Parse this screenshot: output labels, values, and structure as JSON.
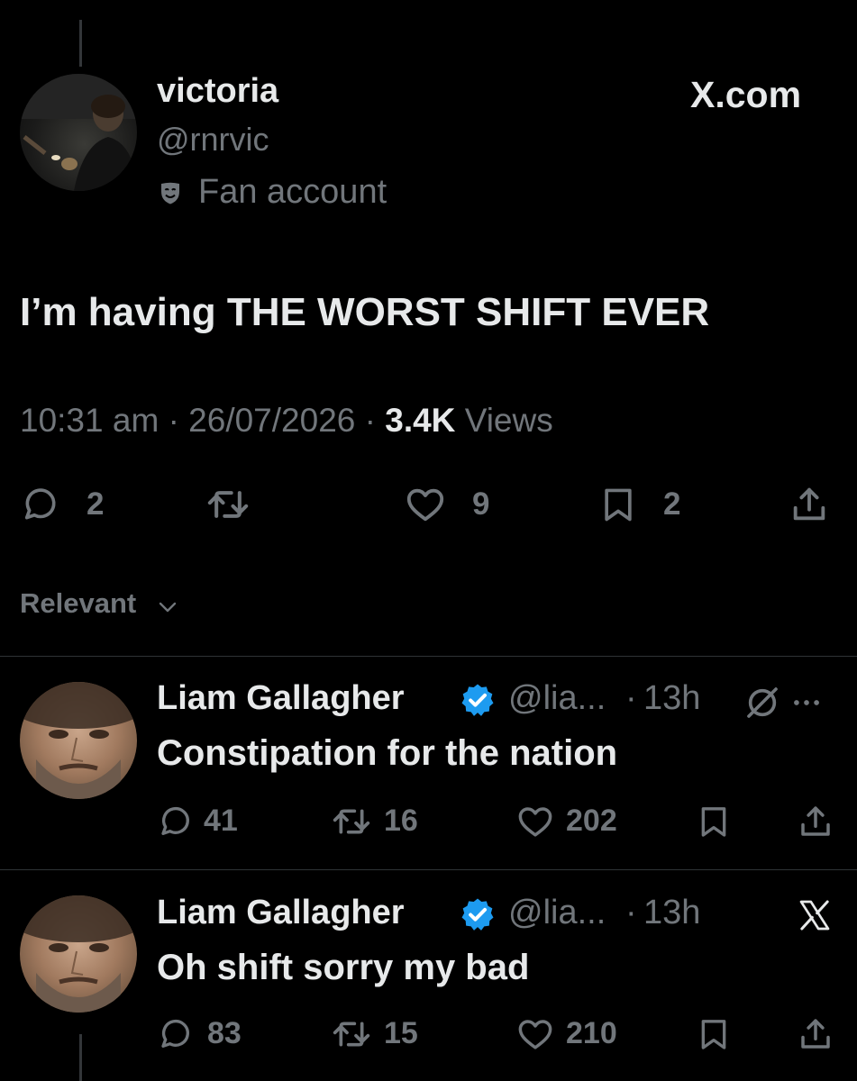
{
  "main_post": {
    "display_name": "victoria",
    "handle": "@rnrvic",
    "badge_label": "Fan account",
    "site_label": "X.com",
    "text": "I’m having THE WORST SHIFT EVER",
    "time": "10:31 am",
    "sep1": "·",
    "date": "26/07/2026",
    "sep2": "·",
    "views_count": "3.4K",
    "views_label": "Views",
    "replies": "2",
    "likes": "9",
    "bookmarks": "2"
  },
  "sort": {
    "label": "Relevant"
  },
  "replies": [
    {
      "display_name": "Liam Gallagher",
      "handle": "@lia...",
      "sep": "·",
      "time": "13h",
      "text": "Constipation for the nation",
      "replies": "41",
      "reposts": "16",
      "likes": "202"
    },
    {
      "display_name": "Liam Gallagher",
      "handle": "@lia...",
      "sep": "·",
      "time": "13h",
      "text": "Oh shift sorry my bad",
      "replies": "83",
      "reposts": "15",
      "likes": "210"
    }
  ],
  "icons": {
    "verified": "verified-badge-icon",
    "grok": "grok-icon",
    "more": "more-icon",
    "x_logo": "x-logo-icon",
    "reply": "reply-icon",
    "repost": "repost-icon",
    "like": "like-icon",
    "bookmark": "bookmark-icon",
    "share": "share-icon",
    "mask": "fan-mask-icon",
    "chevron": "chevron-down-icon"
  },
  "colors": {
    "background": "#000000",
    "text": "#e7e9ea",
    "secondary": "#71767b",
    "verified": "#1d9bf0"
  }
}
